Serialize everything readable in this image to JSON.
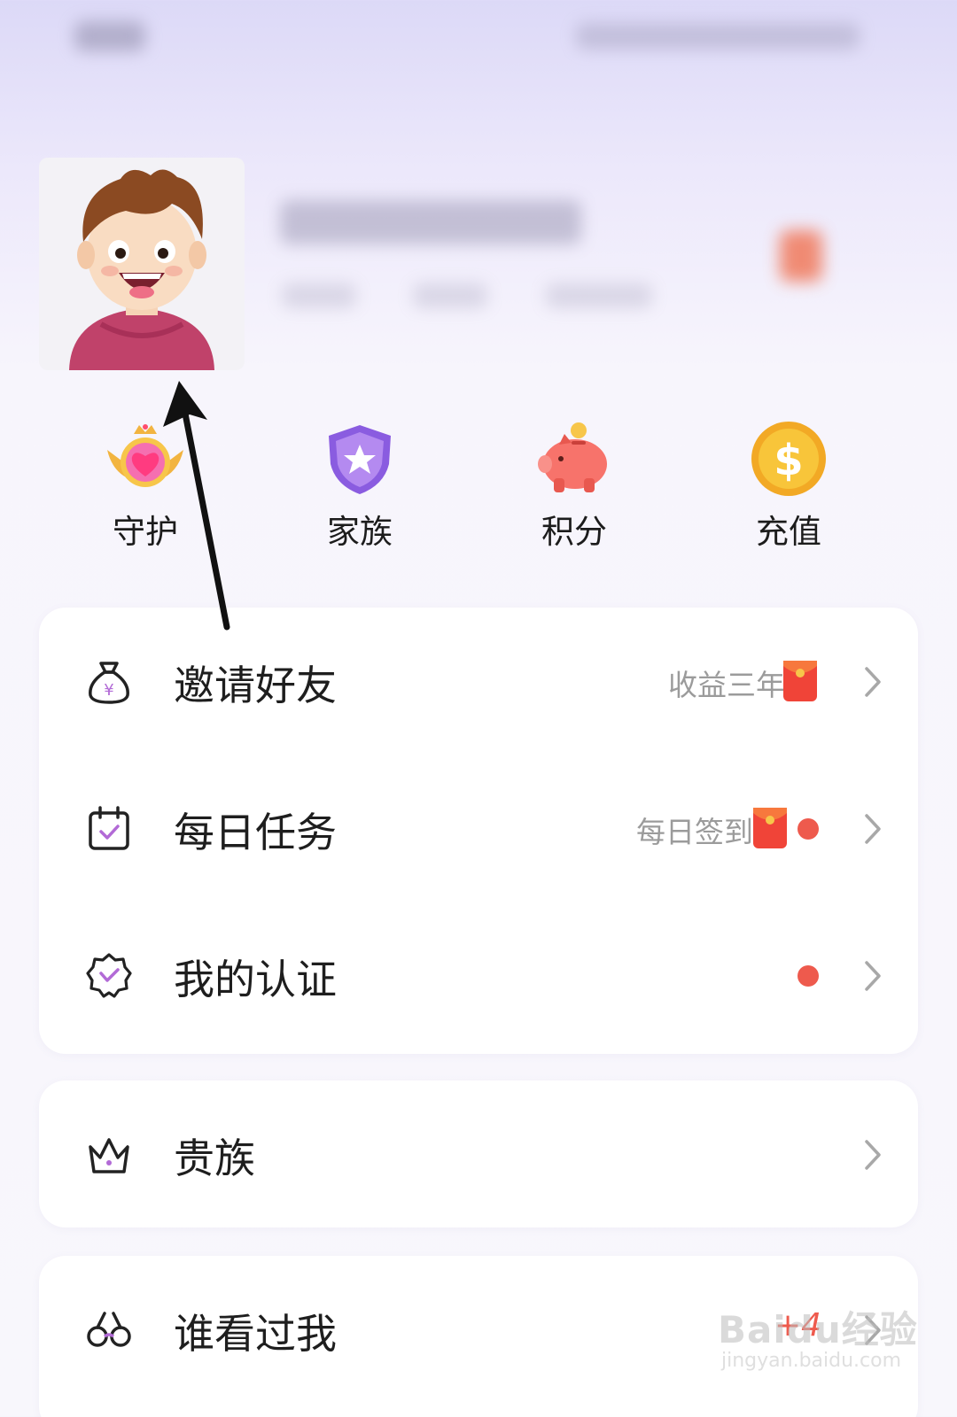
{
  "quick_actions": [
    {
      "label": "守护",
      "icon": "guard-heart-icon"
    },
    {
      "label": "家族",
      "icon": "family-shield-icon"
    },
    {
      "label": "积分",
      "icon": "points-piggy-icon"
    },
    {
      "label": "充值",
      "icon": "recharge-coin-icon"
    }
  ],
  "menu_group_1": [
    {
      "label": "邀请好友",
      "tag": "收益三年",
      "icon": "money-bag-icon",
      "red_packet": true,
      "dot": false
    },
    {
      "label": "每日任务",
      "tag": "每日签到",
      "icon": "calendar-check-icon",
      "red_packet": true,
      "dot": true
    },
    {
      "label": "我的认证",
      "tag": "",
      "icon": "verified-badge-icon",
      "red_packet": false,
      "dot": true
    }
  ],
  "menu_group_2": [
    {
      "label": "贵族",
      "icon": "crown-icon"
    }
  ],
  "menu_group_3": [
    {
      "label": "谁看过我",
      "icon": "glasses-icon",
      "badge": "+4"
    }
  ],
  "watermark": {
    "main": "Baidu经验",
    "sub": "jingyan.baidu.com"
  },
  "colors": {
    "accent_red": "#ee5a4d",
    "icon_purple": "#b26ad6",
    "text_gray": "#9b9b9b"
  }
}
